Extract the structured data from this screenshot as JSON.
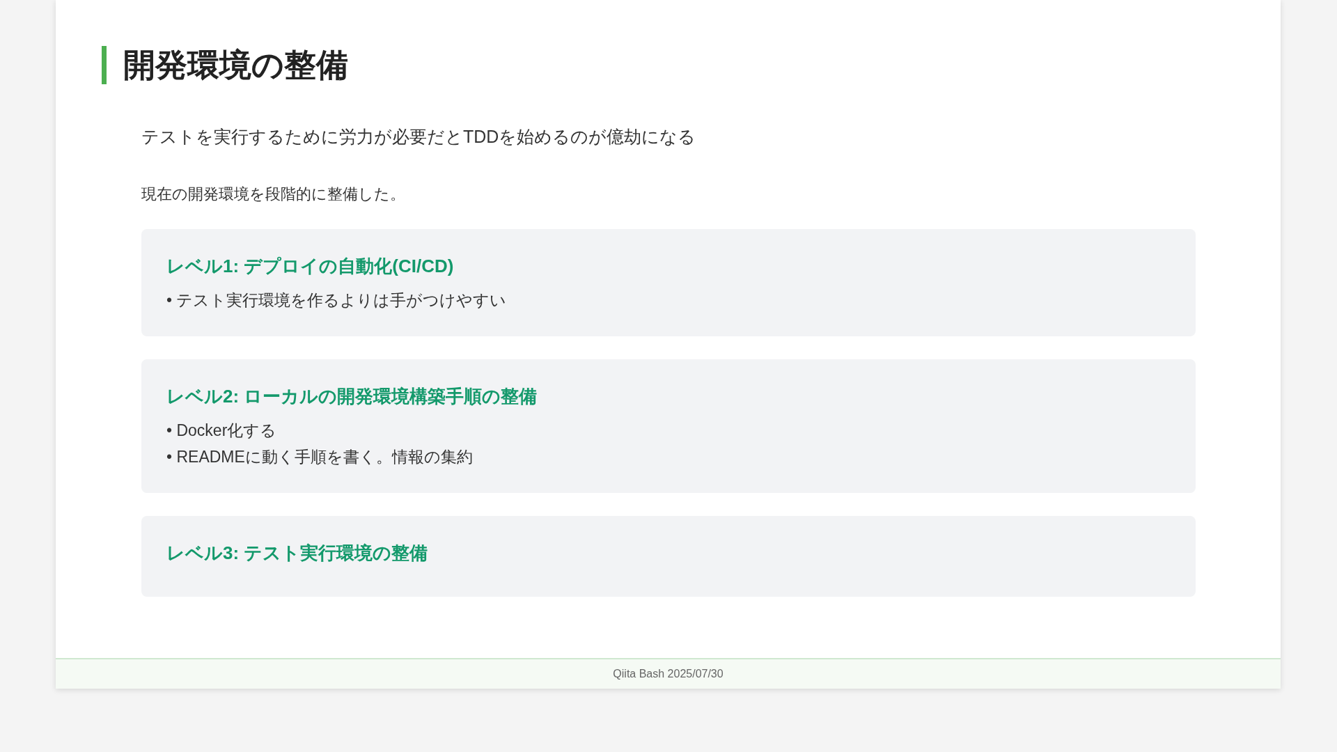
{
  "slide": {
    "title": "開発環境の整備",
    "lead": "テストを実行するために労力が必要だとTDDを始めるのが億劫になる",
    "paragraph": "現在の開発環境を段階的に整備した。",
    "cards": [
      {
        "title": "レベル1: デプロイの自動化(CI/CD)",
        "bullets": [
          "• テスト実行環境を作るよりは手がつけやすい"
        ]
      },
      {
        "title": "レベル2: ローカルの開発環境構築手順の整備",
        "bullets": [
          "• Docker化する",
          "• READMEに動く手順を書く。情報の集約"
        ]
      },
      {
        "title": "レベル3: テスト実行環境の整備"
      }
    ],
    "footer": "Qiita Bash 2025/07/30"
  }
}
